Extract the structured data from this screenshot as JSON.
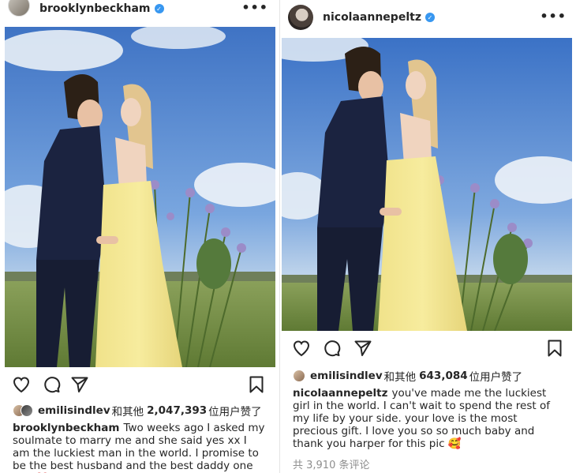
{
  "posts": [
    {
      "username": "brooklynbeckham",
      "verified_badge": "verified-badge-icon",
      "more_icon": "•••",
      "liked_by": "emilisindlev",
      "likes_prefix": "和其他",
      "likes_count": "2,047,393",
      "likes_suffix": "位用户赞了",
      "caption_user": "brooklynbeckham",
      "caption_text": "Two weeks ago I asked my soulmate to marry me and she said yes xx I am the luckiest  man in the world. I promise to be the best husband and the best daddy one day ❤️ I love you"
    },
    {
      "username": "nicolaannepeltz",
      "verified_badge": "verified-badge-icon",
      "more_icon": "•••",
      "liked_by": "emilisindlev",
      "likes_prefix": "和其他",
      "likes_count": "643,084",
      "likes_suffix": "位用户赞了",
      "caption_user": "nicolaannepeltz",
      "caption_text": "you've made me the luckiest girl in the world. I can't wait to spend the rest of my life by your side. your love is the most precious gift. I love you so so much baby and thank you harper for this pic 🥰",
      "comments_count": "共 3,910 条评论"
    }
  ],
  "icons": [
    "heart-icon",
    "comment-icon",
    "share-icon",
    "bookmark-icon",
    "more-icon",
    "verified-badge-icon"
  ],
  "colors": {
    "verified": "#3897f0",
    "text": "#262626",
    "muted": "#8e8e8e"
  }
}
